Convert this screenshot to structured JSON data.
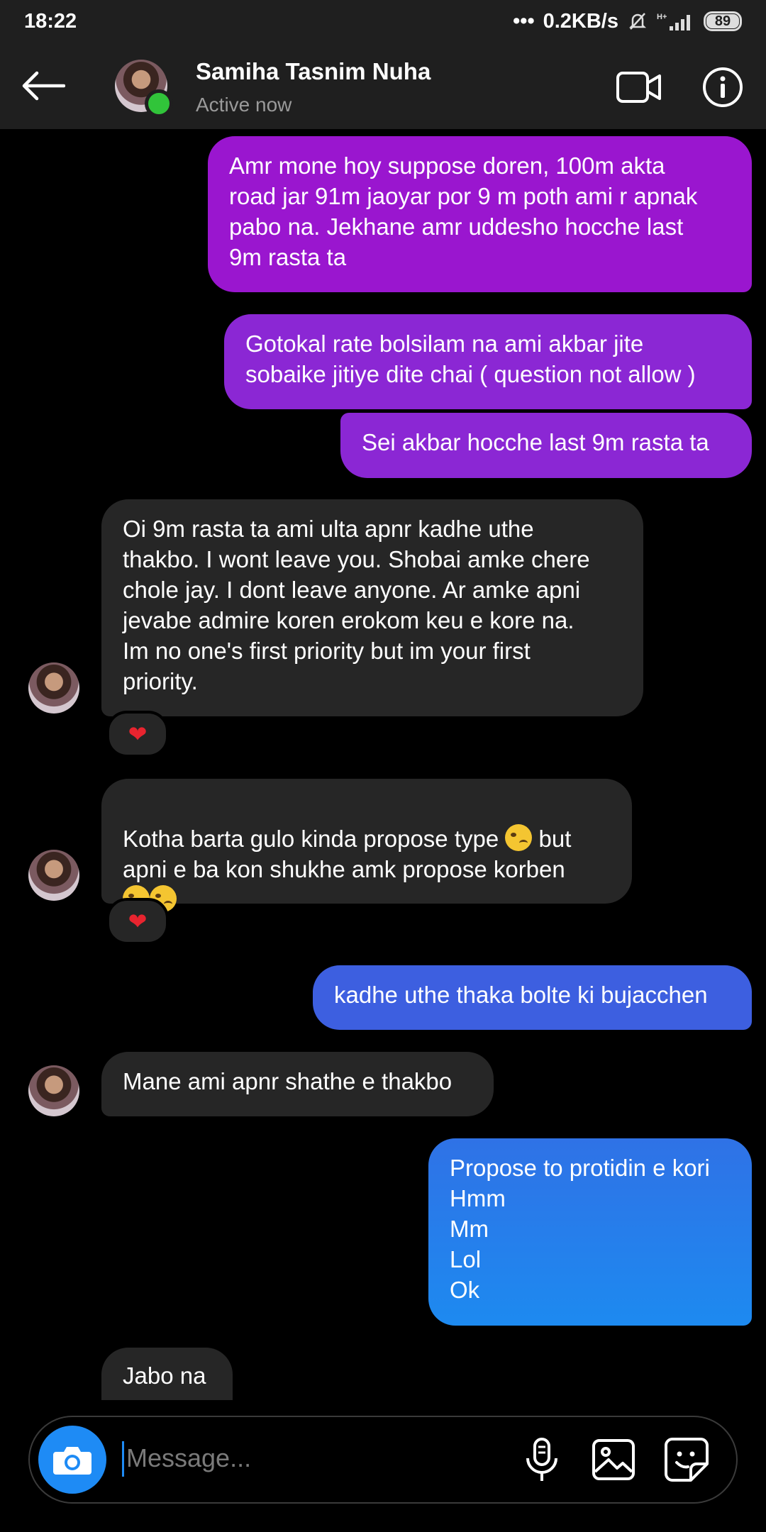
{
  "status_bar": {
    "time": "18:22",
    "network_speed": "0.2KB/s",
    "network_type": "H+",
    "battery": "89"
  },
  "header": {
    "contact_name": "Samiha Tasnim Nuha",
    "contact_status": "Active now",
    "icons": [
      "back-arrow-icon",
      "video-call-icon",
      "info-icon"
    ]
  },
  "messages": [
    {
      "from": "me",
      "text": "Amr mone hoy suppose doren, 100m akta\nroad jar 91m jaoyar por 9 m poth ami r apnak\npabo na. Jekhane amr uddesho hocche last\n9m rasta ta"
    },
    {
      "from": "me",
      "text": "Gotokal rate bolsilam na ami akbar jite\nsobaike jitiye dite chai ( question not allow )"
    },
    {
      "from": "me",
      "text": "Sei akbar hocche last 9m rasta ta"
    },
    {
      "from": "them",
      "text": "Oi 9m rasta ta ami ulta apnr kadhe uthe\nthakbo. I wont leave you. Shobai amke chere\nchole jay. I dont leave anyone. Ar amke apni\njevabe admire koren erokom keu e kore na.\nIm no one's first priority but im your first\npriority.",
      "reaction": "❤"
    },
    {
      "from": "them",
      "text_a": "Kotha barta gulo kinda propose type ",
      "text_b": " but\napni e ba kon shukhe amk propose korben",
      "emoji": "woozy-face-emoji",
      "reaction": "❤"
    },
    {
      "from": "me",
      "text": "kadhe uthe thaka bolte ki bujacchen"
    },
    {
      "from": "them",
      "text": "Mane ami apnr shathe e thakbo"
    },
    {
      "from": "me",
      "text": "Propose to protidin e kori\nHmm\nMm\nLol\nOk"
    },
    {
      "from": "them",
      "text": "Jabo na"
    }
  ],
  "composer": {
    "placeholder": "Message...",
    "value": "",
    "icons": [
      "camera-icon",
      "microphone-icon",
      "image-icon",
      "sticker-icon"
    ]
  },
  "colors": {
    "sent_purple": "#9a16cf",
    "sent_violet": "#8b27d4",
    "sent_blue": "#3d5fe0",
    "sent_light_blue": "#1d8af0",
    "received": "#262626",
    "online": "#31c43a",
    "accent": "#1e8bf5"
  }
}
